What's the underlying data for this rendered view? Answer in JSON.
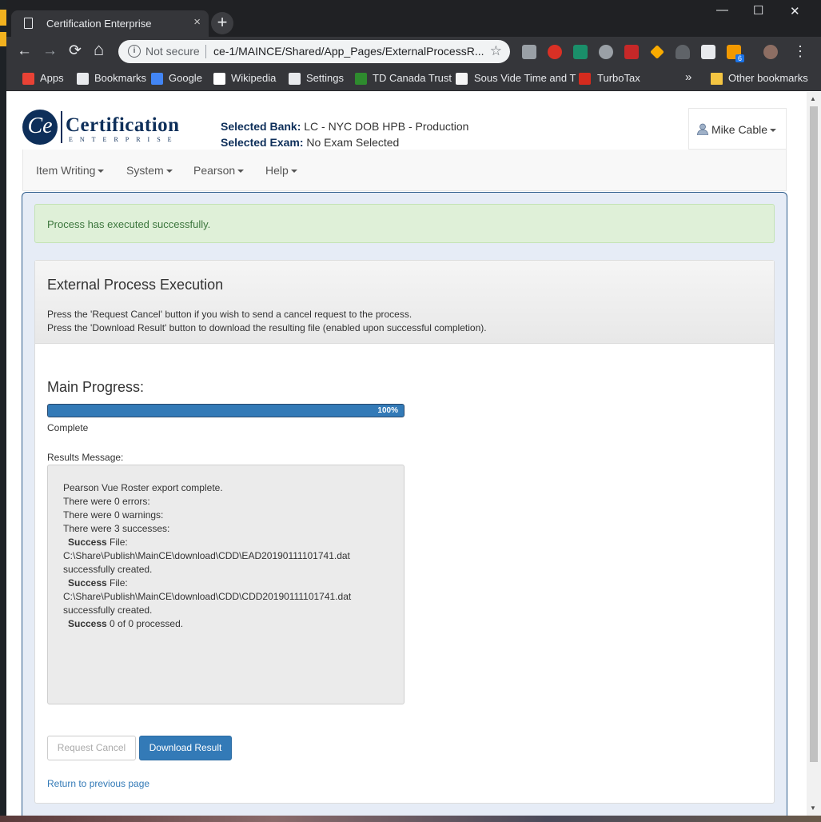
{
  "browser": {
    "tab_title": "Certification Enterprise",
    "tab_close": "×",
    "new_tab": "+",
    "window_controls": {
      "minimize": "—",
      "maximize": "☐",
      "close": "✕"
    },
    "nav": {
      "back": "←",
      "forward": "→",
      "reload": "⟳",
      "home": "⌂"
    },
    "security_label": "Not secure",
    "url": "ce-1/MAINCE/Shared/App_Pages/ExternalProcessR...",
    "star": "☆",
    "menu": "⋮",
    "rss_badge": "6"
  },
  "bookmarks": [
    {
      "label": "Apps",
      "icon": "apps-grid-icon",
      "color": "#e94235"
    },
    {
      "label": "Bookmarks",
      "icon": "star-icon",
      "color": "#e8eaed"
    },
    {
      "label": "Google",
      "icon": "google-icon",
      "color": "#4285f4"
    },
    {
      "label": "Wikipedia",
      "icon": "wikipedia-icon",
      "color": "#ffffff"
    },
    {
      "label": "Settings",
      "icon": "gear-icon",
      "color": "#e8eaed"
    },
    {
      "label": "TD Canada Trust",
      "icon": "td-icon",
      "color": "#2e8b2e"
    },
    {
      "label": "Sous Vide Time and T",
      "icon": "page-icon",
      "color": "#f5f5f5"
    },
    {
      "label": "TurboTax",
      "icon": "check-icon",
      "color": "#d52b1e"
    }
  ],
  "bookmarks_overflow": "»",
  "other_bookmarks": "Other bookmarks",
  "app": {
    "logo_mark": "Ce",
    "logo_word": "Certification",
    "logo_sub": "ENTERPRISE",
    "selected_bank_label": "Selected Bank:",
    "selected_bank_value": "LC - NYC DOB HPB - Production",
    "selected_exam_label": "Selected Exam:",
    "selected_exam_value": "No Exam Selected",
    "user_name": "Mike Cable",
    "menu": [
      "Item Writing",
      "System",
      "Pearson",
      "Help"
    ]
  },
  "alert": "Process has executed successfully.",
  "panel": {
    "title": "External Process Execution",
    "line1": "Press the 'Request Cancel' button if you wish to send a cancel request to the process.",
    "line2": "Press the 'Download Result' button to download the resulting file (enabled upon successful completion).",
    "progress_title": "Main Progress:",
    "progress_value": 1.0,
    "progress_label": "100%",
    "status": "Complete",
    "results_label": "Results Message:",
    "results": {
      "l1": "Pearson Vue Roster export complete.",
      "l2": "There were 0 errors:",
      "l3": "There were 0 warnings:",
      "l4": "There were 3 successes:",
      "s1_b": "Success",
      "s1_t": " File:",
      "s1_path": "C:\\Share\\Publish\\MainCE\\download\\CDD\\EAD20190111101741.dat",
      "s1_end": "successfully created.",
      "s2_b": "Success",
      "s2_t": " File:",
      "s2_path": "C:\\Share\\Publish\\MainCE\\download\\CDD\\CDD20190111101741.dat",
      "s2_end": "successfully created.",
      "s3_b": "Success",
      "s3_t": " 0 of 0 processed."
    },
    "cancel_button": "Request Cancel",
    "download_button": "Download Result",
    "back_link": "Return to previous page"
  },
  "colors": {
    "primary": "#337ab7",
    "brand": "#0e2f5a",
    "success_bg": "#dff0d8",
    "success_text": "#3c763d"
  }
}
